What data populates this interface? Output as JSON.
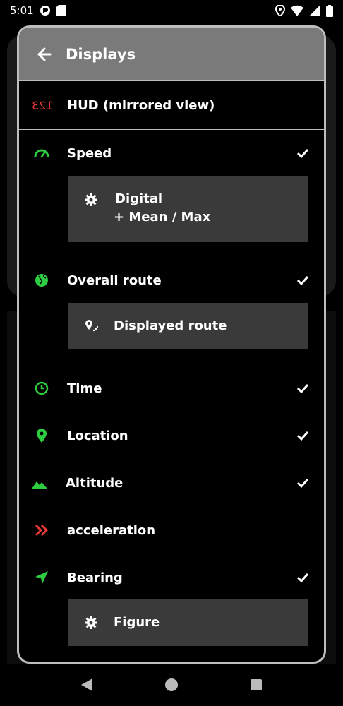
{
  "status_bar": {
    "time": "5:01"
  },
  "dialog": {
    "title": "Displays",
    "hud": {
      "icon_text": "123",
      "label": "HUD (mirrored view)"
    },
    "items": {
      "speed": {
        "label": "Speed",
        "checked": true
      },
      "speed_sub": {
        "line1": "Digital",
        "line2": "+ Mean / Max"
      },
      "overall_route": {
        "label": "Overall route",
        "checked": true
      },
      "route_sub": {
        "label": "Displayed route"
      },
      "time": {
        "label": "Time",
        "checked": true
      },
      "location": {
        "label": "Location",
        "checked": true
      },
      "altitude": {
        "label": "Altitude",
        "checked": true
      },
      "acceleration": {
        "label": "acceleration",
        "checked": false
      },
      "bearing": {
        "label": "Bearing",
        "checked": true
      },
      "bearing_sub": {
        "label": "Figure"
      }
    }
  },
  "colors": {
    "accent_green": "#2ecc40",
    "accent_red": "#e53935",
    "header_gray": "#7a7a7a",
    "sub_box": "#3a3a3a"
  }
}
